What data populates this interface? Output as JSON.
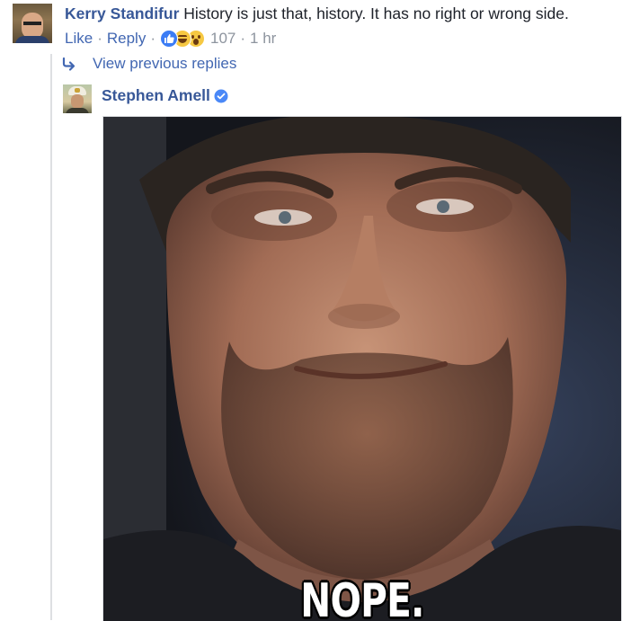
{
  "comment": {
    "author": "Kerry Standifur",
    "text": "History is just that, history. It has no right or wrong side.",
    "actions": {
      "like": "Like",
      "reply": "Reply",
      "separator": "·"
    },
    "reactions": {
      "types": [
        "like-icon",
        "haha-icon",
        "wow-icon"
      ],
      "count": "107"
    },
    "time": "1 hr"
  },
  "thread": {
    "view_previous": "View previous replies"
  },
  "reply": {
    "author": "Stephen Amell",
    "verified": true,
    "gif_caption": "NOPE.",
    "accent_color": "#4267b2"
  },
  "colors": {
    "author": "#385898",
    "link": "#4267b2",
    "meta": "#8d949e",
    "verified_badge": "#4a88f7"
  }
}
